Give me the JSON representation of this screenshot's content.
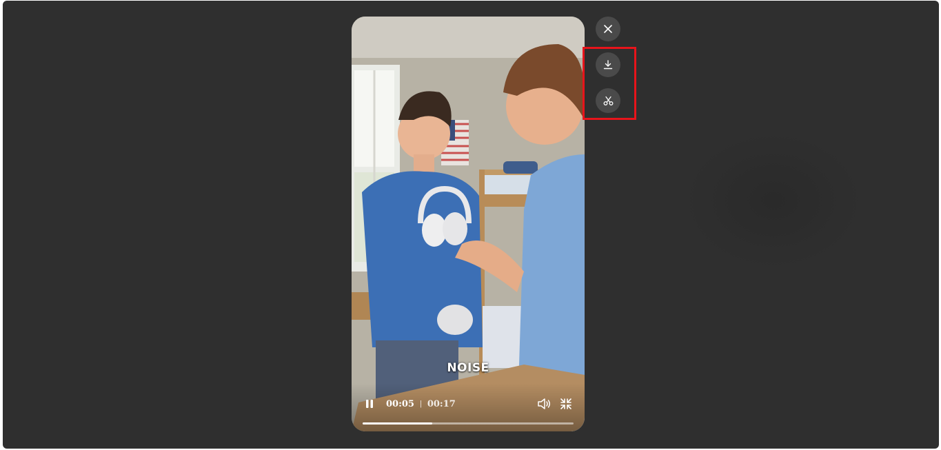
{
  "player": {
    "caption": "NOISE",
    "current_time": "00:05",
    "separator": "|",
    "duration": "00:17",
    "progress_fraction": 0.33
  },
  "controls": {
    "pause_icon": "pause-icon",
    "volume_icon": "volume-icon",
    "exit_fullscreen_icon": "exit-fullscreen-icon"
  },
  "side_actions": {
    "close_icon": "close-icon",
    "download_icon": "download-icon",
    "clip_icon": "scissors-icon"
  },
  "colors": {
    "overlay": "#2f2f2f",
    "button_bg": "#4a4a4a",
    "highlight": "#e8141b"
  }
}
